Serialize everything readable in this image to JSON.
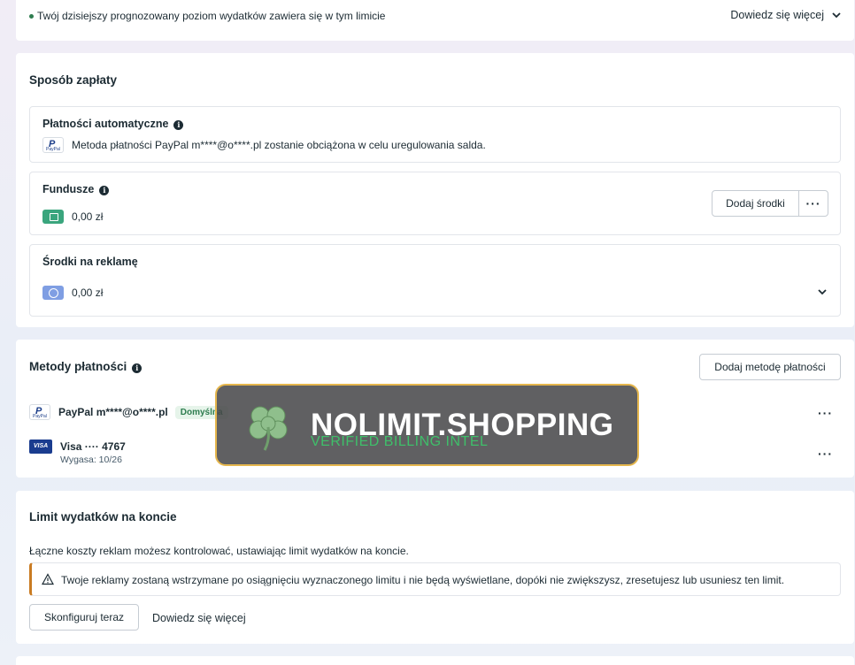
{
  "forecast": {
    "text": "Twój dzisiejszy prognozowany poziom wydatków zawiera się w tym limicie",
    "learn_more": "Dowiedz się więcej"
  },
  "payment_method": {
    "title": "Sposób zapłaty",
    "auto": {
      "heading": "Płatności automatyczne",
      "text": "Metoda płatności PayPal m****@o****.pl zostanie obciążona w celu uregulowania salda."
    },
    "funds": {
      "heading": "Fundusze",
      "amount": "0,00 zł",
      "add_button": "Dodaj środki",
      "more_button": "···"
    },
    "ad_funds": {
      "heading": "Środki na reklamę",
      "amount": "0,00 zł"
    }
  },
  "payment_methods": {
    "title": "Metody płatności",
    "add_button": "Dodaj metodę płatności",
    "items": [
      {
        "name": "PayPal m****@o****.pl",
        "badge": "Domyślna",
        "more": "···"
      },
      {
        "name": "Visa ···· 4767",
        "expiry": "Wygasa: 10/26",
        "logo": "VISA",
        "more": "···"
      }
    ]
  },
  "spending_limit": {
    "title": "Limit wydatków na koncie",
    "description": "Łączne koszty reklam możesz kontrolować, ustawiając limit wydatków na koncie.",
    "warning": "Twoje reklamy zostaną wstrzymane po osiągnięciu wyznaczonego limitu i nie będą wyświetlane, dopóki nie zwiększysz, zresetujesz lub usuniesz ten limit.",
    "configure_button": "Skonfiguruj teraz",
    "learn_more": "Dowiedz się więcej"
  },
  "watermark": {
    "brand": "NOLIMIT.SHOPPING",
    "tagline": "VERIFIED BILLING INTEL"
  },
  "colors": {
    "brand_gold": "#e5b64d",
    "tag_green": "#3fbf6a",
    "warning_orange": "#c97b22",
    "funds_green": "#3aa57d",
    "ad_funds_blue": "#7f9ee3"
  },
  "icons": [
    "chevron-down-icon",
    "info-icon",
    "paypal-icon",
    "wallet-icon",
    "ad-credit-icon",
    "visa-icon",
    "warning-icon",
    "clover-icon",
    "more-icon"
  ]
}
